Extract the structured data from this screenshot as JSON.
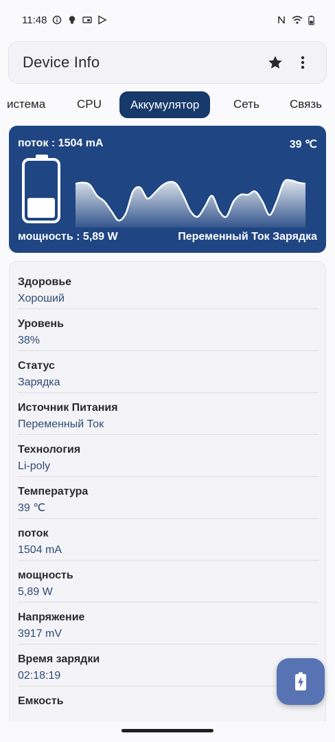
{
  "status_bar": {
    "time": "11:48",
    "left_icons": [
      "info-circle-icon",
      "lightbulb-icon",
      "cast-icon",
      "play-store-icon"
    ],
    "right_icons": [
      "nfc-icon",
      "wifi-icon",
      "battery-icon"
    ]
  },
  "app_bar": {
    "title": "Device Info",
    "favorite_icon": "star-icon",
    "menu_icon": "more-vert-icon"
  },
  "tabs": [
    {
      "label": "истема",
      "active": false
    },
    {
      "label": "CPU",
      "active": false
    },
    {
      "label": "Аккумулятор",
      "active": true
    },
    {
      "label": "Сеть",
      "active": false
    },
    {
      "label": "Связь",
      "active": false
    }
  ],
  "battery_card": {
    "current": "поток : 1504 mA",
    "temperature": "39 ℃",
    "power": "мощность : 5,89 W",
    "source_status": "Переменный Ток Зарядка",
    "level_fraction": 0.38,
    "graph_values": [
      0.72,
      0.74,
      0.7,
      0.5,
      0.4,
      0.22,
      0.05,
      0.18,
      0.58,
      0.65,
      0.45,
      0.55,
      0.68,
      0.75,
      0.72,
      0.5,
      0.22,
      0.12,
      0.3,
      0.5,
      0.22,
      0.12,
      0.4,
      0.52,
      0.52,
      0.58,
      0.4,
      0.15,
      0.4,
      0.75,
      0.78,
      0.74,
      0.72
    ]
  },
  "info_items": [
    {
      "label": "Здоровье",
      "value": "Хороший"
    },
    {
      "label": "Уровень",
      "value": "38%"
    },
    {
      "label": "Статус",
      "value": "Зарядка"
    },
    {
      "label": "Источник Питания",
      "value": "Переменный Ток"
    },
    {
      "label": "Технология",
      "value": "Li-poly"
    },
    {
      "label": "Температура",
      "value": "39 ℃"
    },
    {
      "label": "поток",
      "value": "1504 mA"
    },
    {
      "label": "мощность",
      "value": "5,89 W"
    },
    {
      "label": "Напряжение",
      "value": "3917 mV"
    },
    {
      "label": "Время зарядки",
      "value": "02:18:19"
    },
    {
      "label": "Емкость",
      "value": ""
    }
  ],
  "fab": {
    "icon": "battery-charging-icon"
  },
  "colors": {
    "accent": "#173a6b",
    "card_bg": "#1f4582",
    "value_text": "#2c4a73",
    "fab_bg": "#5773b3"
  }
}
